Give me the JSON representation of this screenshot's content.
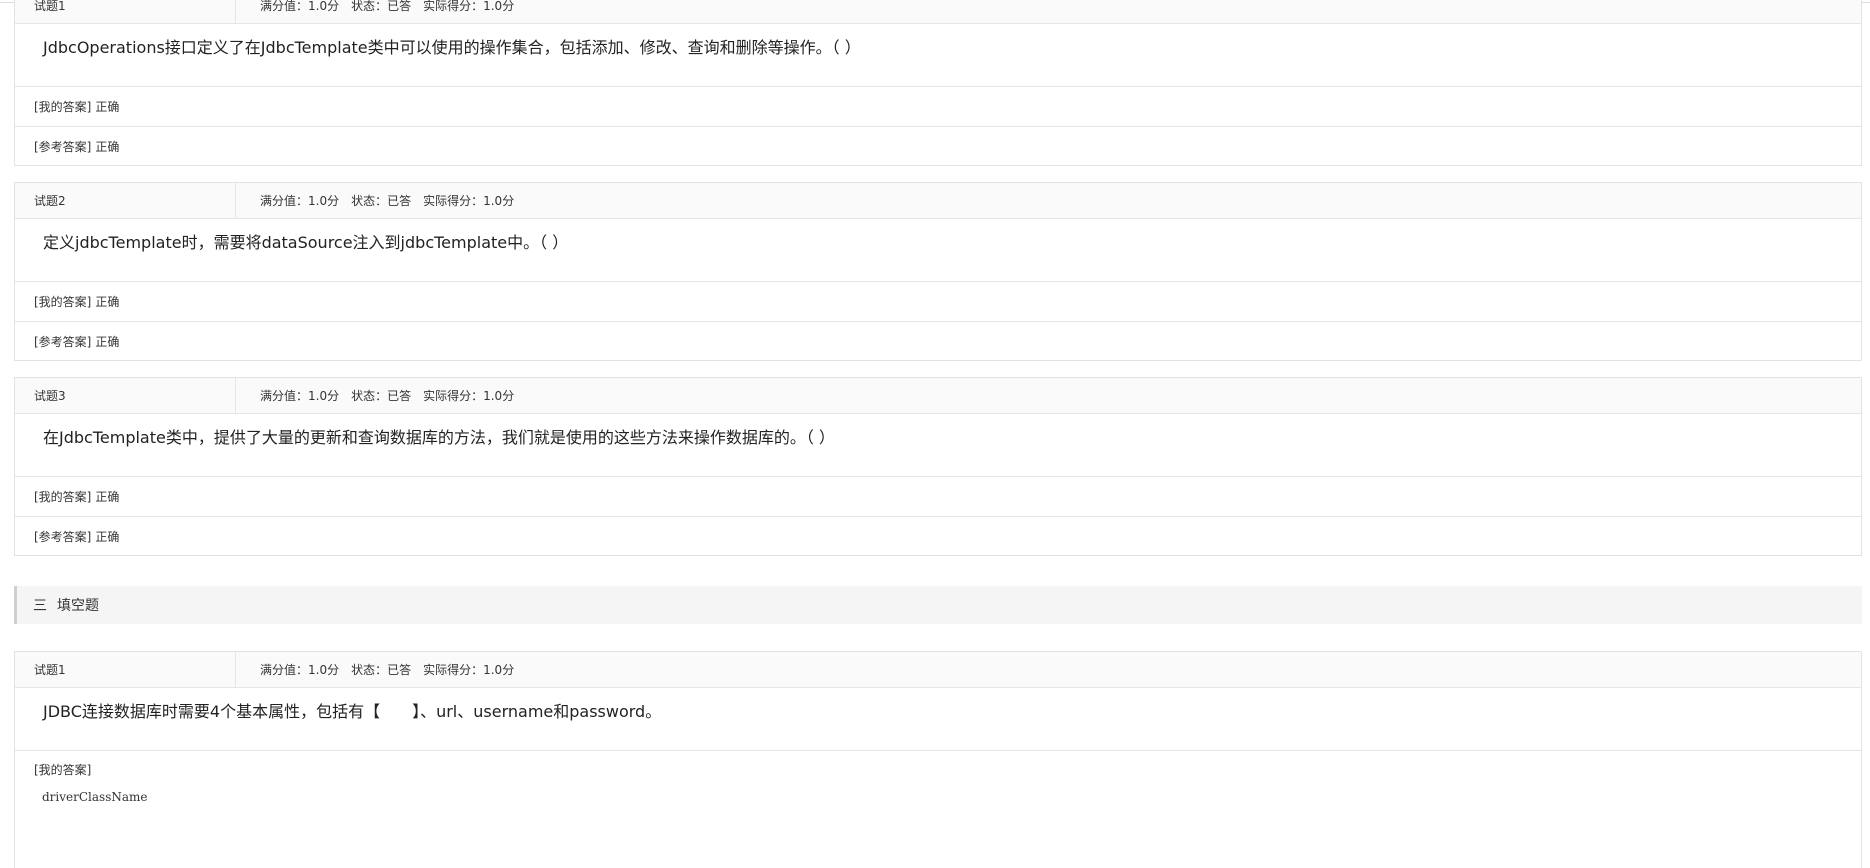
{
  "labels": {
    "max_score": "满分值：1.0分",
    "status": "状态：已答",
    "actual_score": "实际得分：1.0分",
    "my_answer": "[我的答案]",
    "ref_answer": "[参考答案]"
  },
  "judge_questions": [
    {
      "number": "试题1",
      "text": "JdbcOperations接口定义了在JdbcTemplate类中可以使用的操作集合，包括添加、修改、查询和删除等操作。（ ）",
      "my_answer": "正确",
      "ref_answer": "正确"
    },
    {
      "number": "试题2",
      "text": "定义jdbcTemplate时，需要将dataSource注入到jdbcTemplate中。（ ）",
      "my_answer": "正确",
      "ref_answer": "正确"
    },
    {
      "number": "试题3",
      "text": "在JdbcTemplate类中，提供了大量的更新和查询数据库的方法，我们就是使用的这些方法来操作数据库的。（ ）",
      "my_answer": "正确",
      "ref_answer": "正确"
    }
  ],
  "section": {
    "number": "三",
    "title": "填空题"
  },
  "fill_question": {
    "number": "试题1",
    "text": "JDBC连接数据库时需要4个基本属性，包括有【　　】、url、username和password。",
    "my_answer": "driverClassName"
  }
}
